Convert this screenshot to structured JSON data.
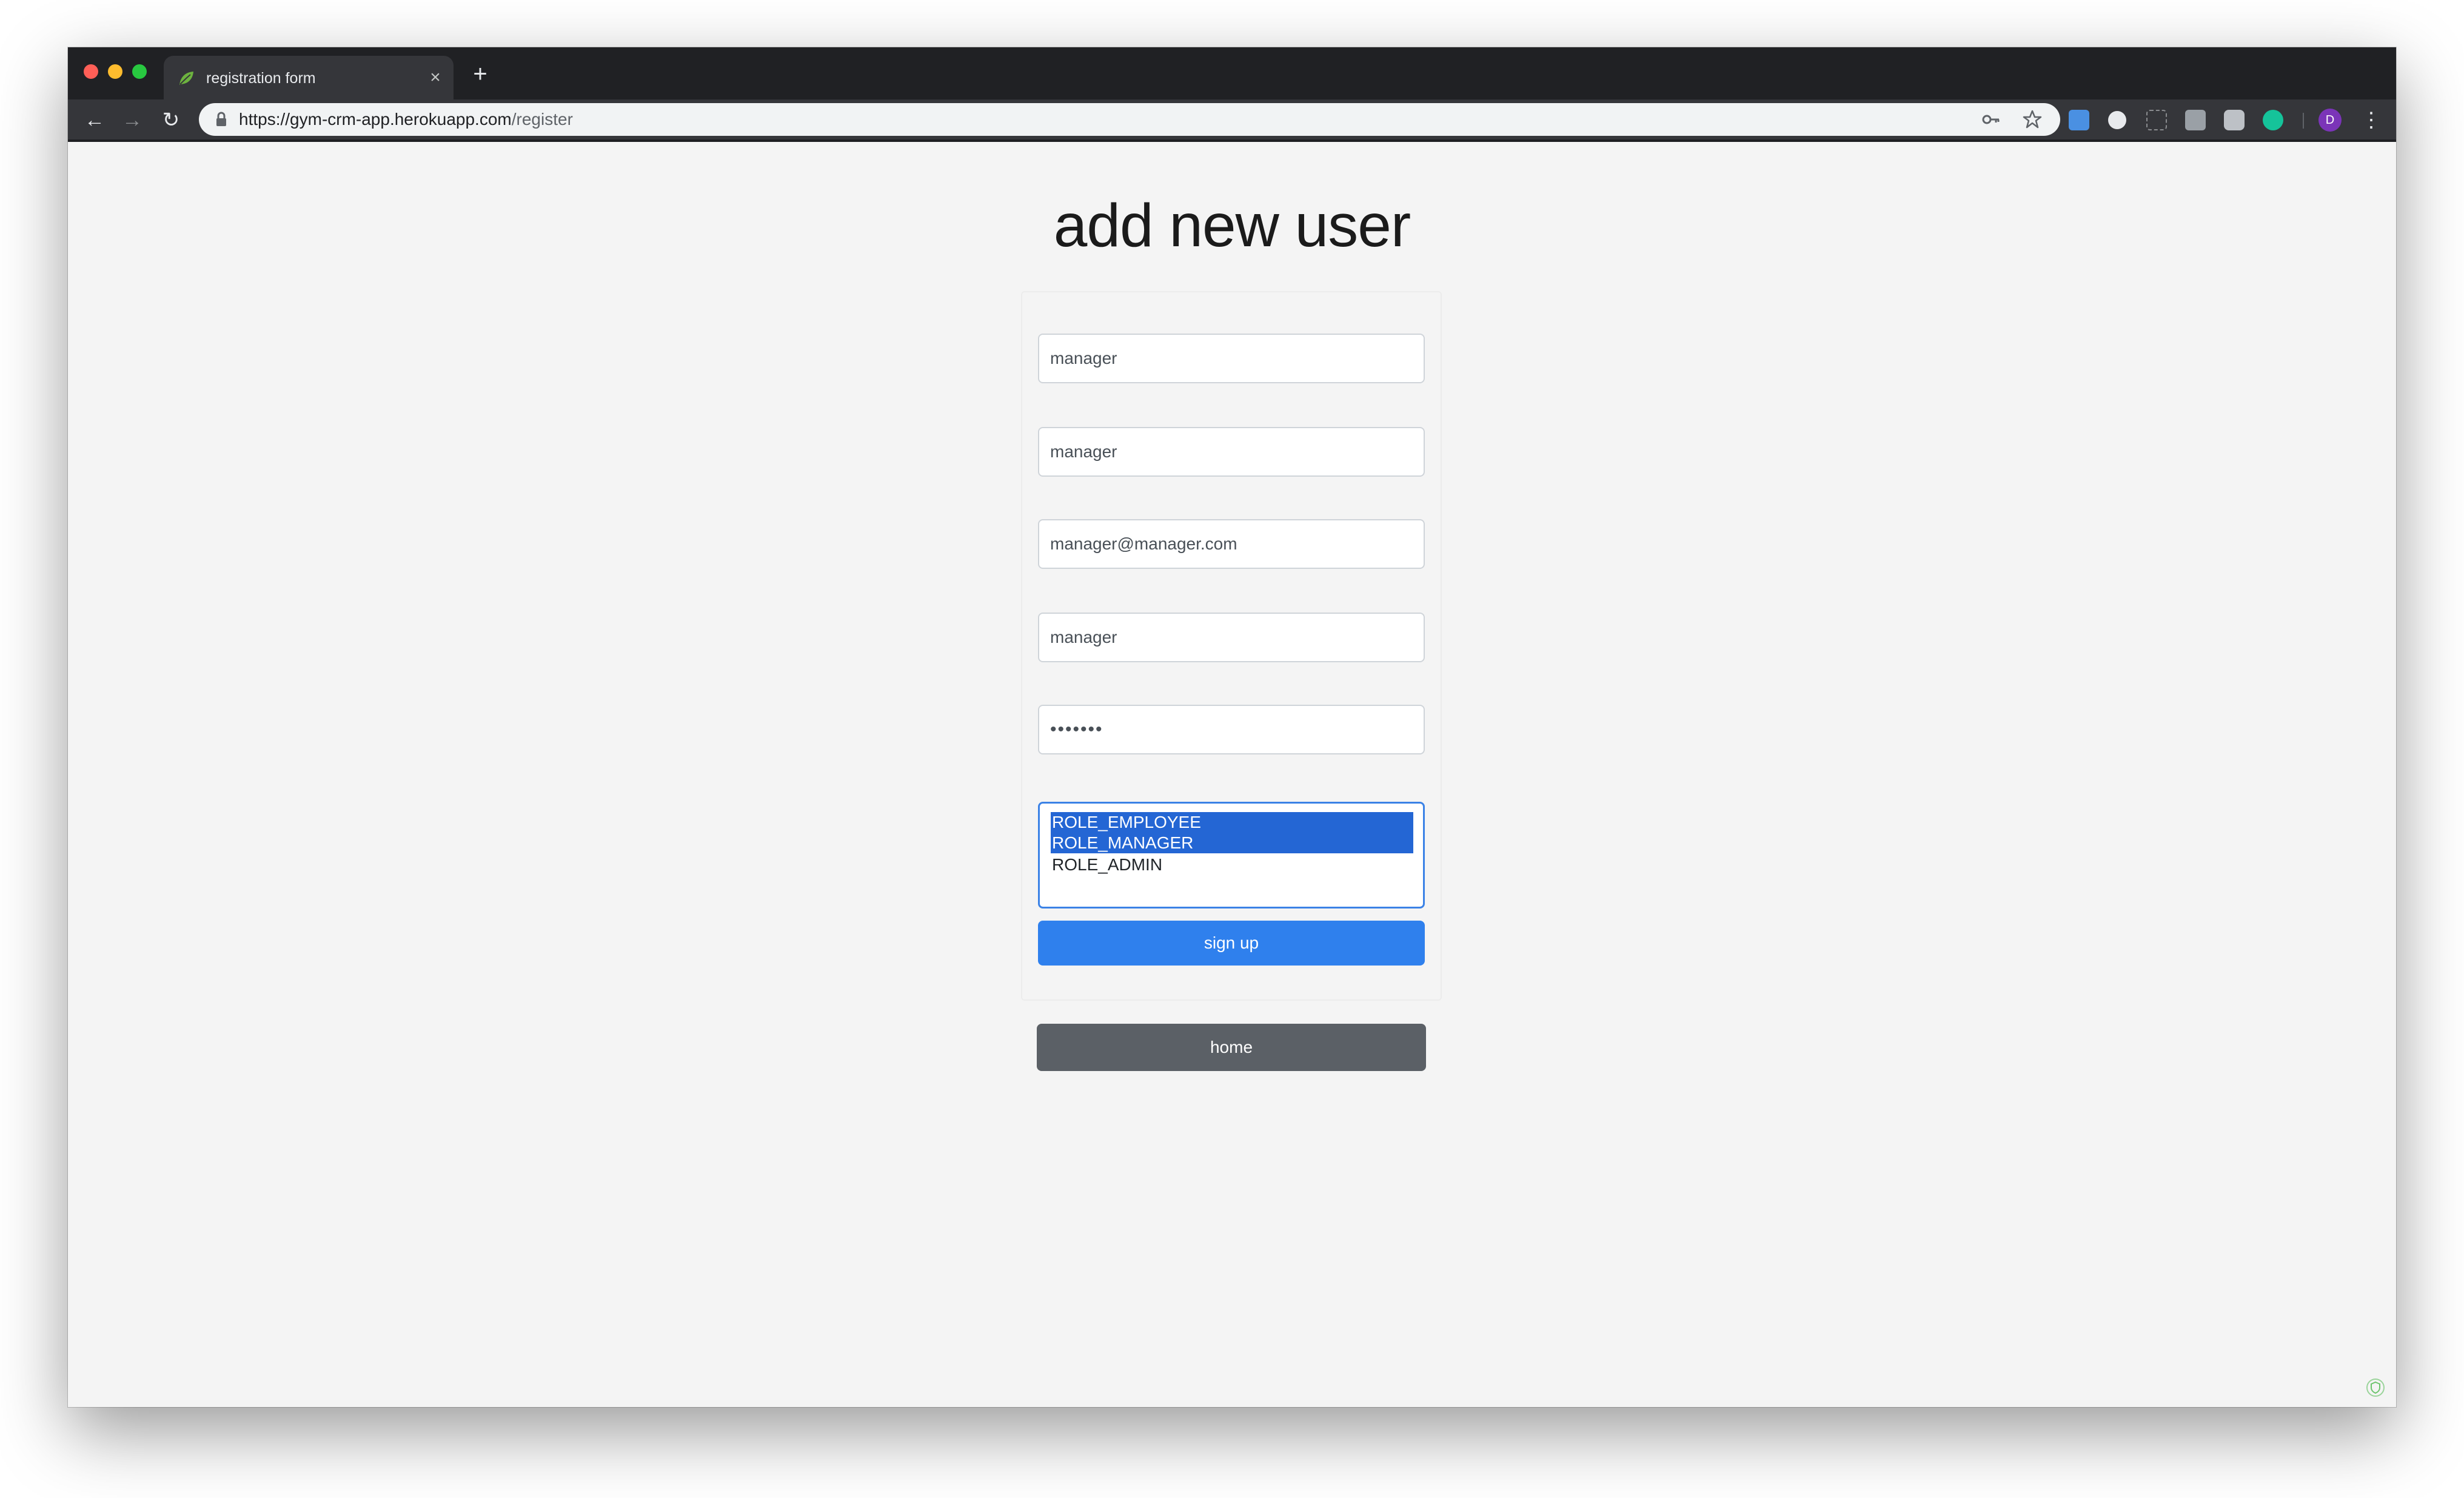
{
  "browser": {
    "tab_title": "registration form",
    "url_host": "https://gym-crm-app.herokuapp.com",
    "url_path": "/register",
    "avatar_initial": "D",
    "accent": "#2f80ed",
    "icons": [
      "back-arrow-icon",
      "forward-arrow-icon",
      "reload-icon",
      "lock-icon",
      "key-icon",
      "star-icon",
      "menu-dots-icon"
    ]
  },
  "page": {
    "title": "add new user"
  },
  "form": {
    "username_value": "manager",
    "password_value": "manager",
    "email_value": "manager@manager.com",
    "field4_value": "manager",
    "masked_password": "•••••••",
    "roles": [
      {
        "label": "ROLE_EMPLOYEE",
        "selected": true
      },
      {
        "label": "ROLE_MANAGER",
        "selected": true
      },
      {
        "label": "ROLE_ADMIN",
        "selected": false
      }
    ],
    "submit_label": "sign up"
  },
  "footer": {
    "home_label": "home"
  }
}
